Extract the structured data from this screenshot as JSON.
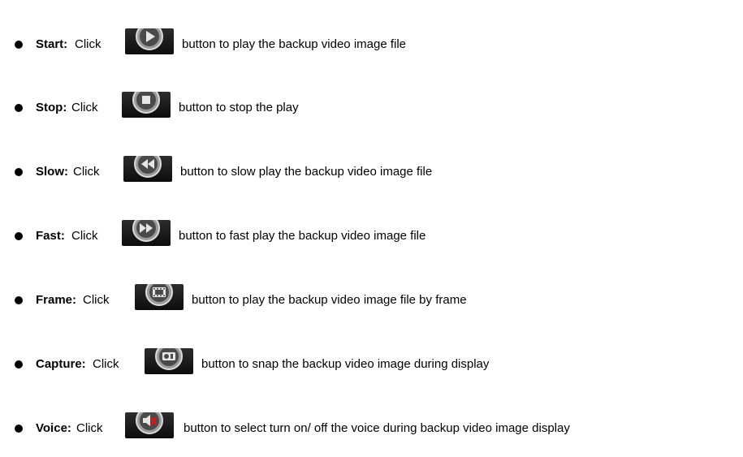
{
  "items": [
    {
      "label": "Start:",
      "click": "Click",
      "icon": "play-icon",
      "description": "button to play the backup video image file"
    },
    {
      "label": "Stop:",
      "click": "Click",
      "icon": "stop-icon",
      "description": "button to stop the play"
    },
    {
      "label": "Slow:",
      "click": "Click",
      "icon": "rewind-icon",
      "description": "button to slow play the backup video image file"
    },
    {
      "label": "Fast:",
      "click": "Click",
      "icon": "fast-forward-icon",
      "description": "button to fast play the backup video image file"
    },
    {
      "label": "Frame:",
      "click": "Click",
      "icon": "film-frame-icon",
      "description": "button to play the backup video image file by frame"
    },
    {
      "label": "Capture:",
      "click": "Click",
      "icon": "camera-capture-icon",
      "description": "button to snap the backup video image during display"
    },
    {
      "label": "Voice:",
      "click": "Click",
      "icon": "speaker-mute-icon",
      "description": "button to select turn on/ off the voice during backup video image display"
    }
  ],
  "colors": {
    "button_bg": "#1a1a1a",
    "button_ring": "#c8c8c8",
    "button_inner": "#3a3a3a",
    "glyph": "#e6e6e6",
    "mute_red": "#d11a1a"
  }
}
